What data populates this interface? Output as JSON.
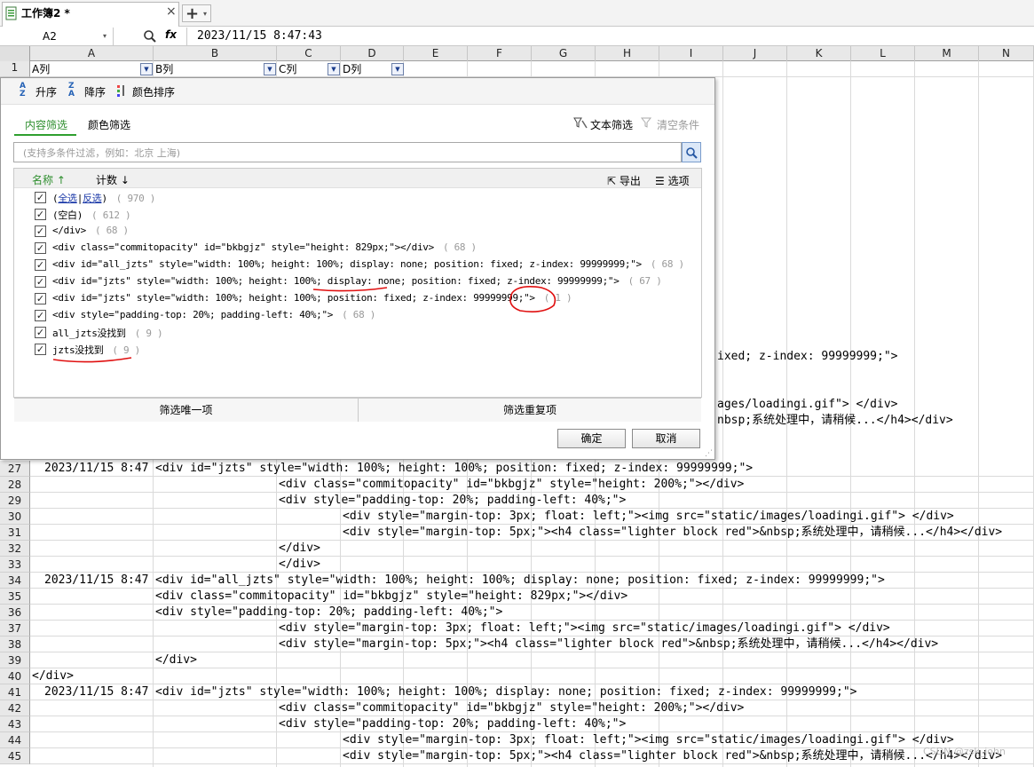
{
  "tab": {
    "title": "工作簿2 *",
    "close": "×",
    "add": "+",
    "menu": "▾"
  },
  "formula_bar": {
    "name_box": "A2",
    "fx": "fx",
    "content": "2023/11/15  8:47:43"
  },
  "columns": [
    "A",
    "B",
    "C",
    "D",
    "E",
    "F",
    "G",
    "H",
    "I",
    "J",
    "K",
    "L",
    "M",
    "N"
  ],
  "header_row": {
    "A": "A列",
    "B": "B列",
    "C": "C列",
    "D": "D列"
  },
  "row_numbers_top": [
    "1"
  ],
  "rows": [
    {
      "n": "27",
      "cells": [
        {
          "col": "A",
          "text": "2023/11/15 8:47"
        },
        {
          "col": "B",
          "text": "<div id=\"jzts\" style=\"width: 100%; height: 100%; position: fixed; z-index: 99999999;\">"
        }
      ]
    },
    {
      "n": "28",
      "cells": [
        {
          "col": "C",
          "text": "<div class=\"commitopacity\" id=\"bkbgjz\" style=\"height: 200%;\"></div>"
        }
      ]
    },
    {
      "n": "29",
      "cells": [
        {
          "col": "C",
          "text": "<div style=\"padding-top: 20%; padding-left: 40%;\">"
        }
      ]
    },
    {
      "n": "30",
      "cells": [
        {
          "col": "D",
          "text": "<div style=\"margin-top: 3px; float: left;\"><img src=\"static/images/loadingi.gif\"> </div>"
        }
      ]
    },
    {
      "n": "31",
      "cells": [
        {
          "col": "D",
          "text": "<div style=\"margin-top: 5px;\"><h4 class=\"lighter block red\">&nbsp;系统处理中，请稍候...</h4></div>"
        }
      ]
    },
    {
      "n": "32",
      "cells": [
        {
          "col": "C",
          "text": "</div>"
        }
      ]
    },
    {
      "n": "33",
      "cells": [
        {
          "col": "C",
          "text": "</div>"
        }
      ]
    },
    {
      "n": "34",
      "cells": [
        {
          "col": "A",
          "text": "2023/11/15 8:47"
        },
        {
          "col": "B",
          "text": "<div id=\"all_jzts\" style=\"width: 100%; height: 100%; display: none; position: fixed; z-index: 99999999;\">"
        }
      ]
    },
    {
      "n": "35",
      "cells": [
        {
          "col": "B",
          "text": "<div class=\"commitopacity\" id=\"bkbgjz\" style=\"height: 829px;\"></div>"
        }
      ]
    },
    {
      "n": "36",
      "cells": [
        {
          "col": "B",
          "text": "<div style=\"padding-top: 20%; padding-left: 40%;\">"
        }
      ]
    },
    {
      "n": "37",
      "cells": [
        {
          "col": "C",
          "text": "<div style=\"margin-top: 3px; float: left;\"><img src=\"static/images/loadingi.gif\"> </div>"
        }
      ]
    },
    {
      "n": "38",
      "cells": [
        {
          "col": "C",
          "text": "<div style=\"margin-top: 5px;\"><h4 class=\"lighter block red\">&nbsp;系统处理中，请稍候...</h4></div>"
        }
      ]
    },
    {
      "n": "39",
      "cells": [
        {
          "col": "B",
          "text": "</div>"
        }
      ]
    },
    {
      "n": "40",
      "cells": [
        {
          "col": "A0",
          "text": "</div>"
        }
      ]
    },
    {
      "n": "41",
      "cells": [
        {
          "col": "A",
          "text": "2023/11/15 8:47"
        },
        {
          "col": "B",
          "text": "<div id=\"jzts\" style=\"width: 100%; height: 100%; display: none; position: fixed; z-index: 99999999;\">"
        }
      ]
    },
    {
      "n": "42",
      "cells": [
        {
          "col": "C",
          "text": "<div class=\"commitopacity\" id=\"bkbgjz\" style=\"height: 200%;\"></div>"
        }
      ]
    },
    {
      "n": "43",
      "cells": [
        {
          "col": "C",
          "text": "<div style=\"padding-top: 20%; padding-left: 40%;\">"
        }
      ]
    },
    {
      "n": "44",
      "cells": [
        {
          "col": "D",
          "text": "<div style=\"margin-top: 3px; float: left;\"><img src=\"static/images/loadingi.gif\"> </div>"
        }
      ]
    },
    {
      "n": "45",
      "cells": [
        {
          "col": "D",
          "text": "<div style=\"margin-top: 5px;\"><h4 class=\"lighter block red\">&nbsp;系统处理中，请稍候...</h4></div>"
        }
      ]
    }
  ],
  "peek_cells": [
    {
      "row": "r22",
      "text": "ixed; z-index: 99999999;\">"
    },
    {
      "row": "r25",
      "text": "ages/loadingi.gif\"> </div>"
    },
    {
      "row": "r26",
      "text": "nbsp;系统处理中，请稍候...</h4></div>"
    }
  ],
  "filter_popup": {
    "sort": {
      "asc": "升序",
      "desc": "降序",
      "color": "颜色排序"
    },
    "tabs": {
      "content": "内容筛选",
      "color": "颜色筛选"
    },
    "text_filter": "文本筛选",
    "clear_conditions": "清空条件",
    "search_placeholder": "(支持多条件过滤，例如：北京  上海)",
    "list_header": {
      "name": "名称",
      "count": "计数",
      "export": "导出",
      "options": "选项"
    },
    "select_all": "全选",
    "invert": "反选",
    "items": [
      {
        "text": "(空白)",
        "count": "( 612 )"
      },
      {
        "text": "</div>",
        "count": "( 68 )"
      },
      {
        "text": "<div class=\"commitopacity\" id=\"bkbgjz\" style=\"height: 829px;\"></div>",
        "count": "( 68 )"
      },
      {
        "text": "<div id=\"all_jzts\" style=\"width: 100%; height: 100%; display: none; position: fixed; z-index: 99999999;\">",
        "count": "( 68 )"
      },
      {
        "text": "<div id=\"jzts\" style=\"width: 100%; height: 100%; display: none; position: fixed; z-index: 99999999;\">",
        "count": "( 67 )"
      },
      {
        "text": "<div id=\"jzts\" style=\"width: 100%; height: 100%; position: fixed; z-index: 99999999;\">",
        "count": "( 1 )"
      },
      {
        "text": "<div style=\"padding-top: 20%; padding-left: 40%;\">",
        "count": "( 68 )"
      },
      {
        "text": "all_jzts没找到",
        "count": "( 9 )"
      },
      {
        "text": "jzts没找到",
        "count": "( 9 )"
      }
    ],
    "select_all_count": "( 970 )",
    "btn_unique": "筛选唯一项",
    "btn_duplicate": "筛选重复项",
    "ok": "确定",
    "cancel": "取消"
  },
  "colors": {
    "accent_green": "#2f8f2f",
    "annotation_red": "#e01010",
    "link_blue": "#1b39a8"
  },
  "watermark": "CSDN @zsk_john"
}
